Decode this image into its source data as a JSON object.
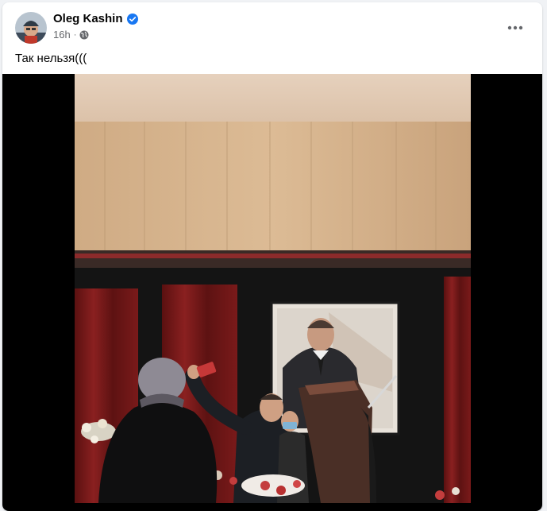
{
  "post": {
    "author": "Oleg Kashin",
    "verified": true,
    "time": "16h",
    "separator": "·",
    "audience_icon": "globe-icon",
    "text": "Так нельзя(((",
    "more_icon": "more-options-icon"
  },
  "colors": {
    "page_bg": "#f0f2f5",
    "card_bg": "#ffffff",
    "verified_blue": "#1877f2",
    "secondary_text": "#65676b",
    "primary_text": "#050505"
  }
}
